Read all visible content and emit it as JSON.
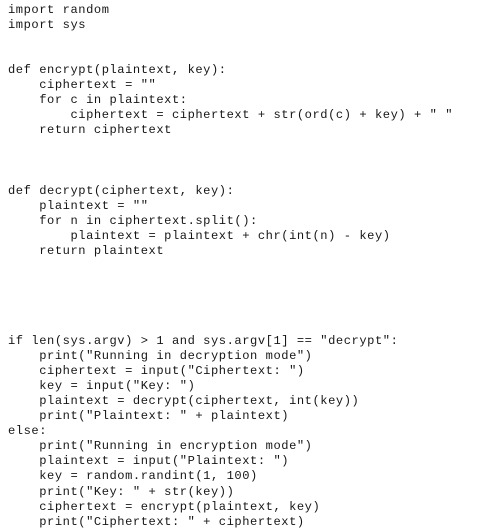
{
  "document": {
    "kind": "code-listing",
    "language": "Python",
    "background_color": "#ffffff",
    "text_color": "#161616",
    "total_lines": 34,
    "lines": [
      "import random",
      "import sys",
      "",
      "",
      "def encrypt(plaintext, key):",
      "    ciphertext = \"\"",
      "    for c in plaintext:",
      "        ciphertext = ciphertext + str(ord(c) + key) + \" \"",
      "    return ciphertext",
      "",
      "",
      "",
      "def decrypt(ciphertext, key):",
      "    plaintext = \"\"",
      "    for n in ciphertext.split():",
      "        plaintext = plaintext + chr(int(n) - key)",
      "    return plaintext",
      "",
      "",
      "",
      "",
      "",
      "if len(sys.argv) > 1 and sys.argv[1] == \"decrypt\":",
      "    print(\"Running in decryption mode\")",
      "    ciphertext = input(\"Ciphertext: \")",
      "    key = input(\"Key: \")",
      "    plaintext = decrypt(ciphertext, int(key))",
      "    print(\"Plaintext: \" + plaintext)",
      "else:",
      "    print(\"Running in encryption mode\")",
      "    plaintext = input(\"Plaintext: \")",
      "    key = random.randint(1, 100)",
      "    print(\"Key: \" + str(key))",
      "    ciphertext = encrypt(plaintext, key)",
      "    print(\"Ciphertext: \" + ciphertext)"
    ]
  }
}
